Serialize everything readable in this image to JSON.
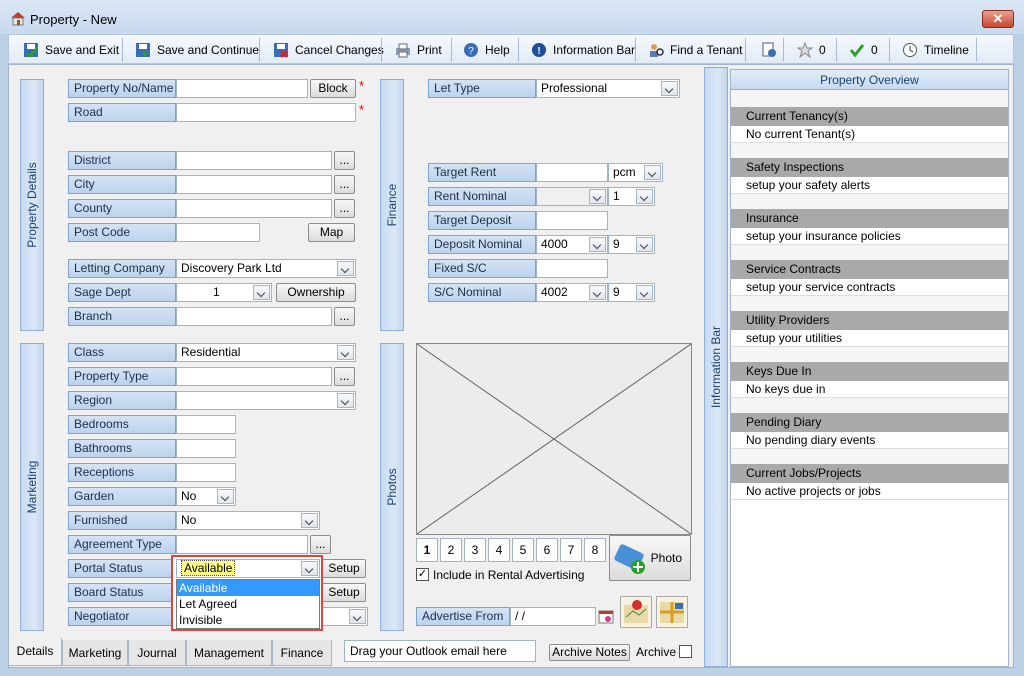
{
  "window": {
    "title": "Property  - New",
    "close": "✕"
  },
  "toolbar": {
    "save_exit": "Save and Exit",
    "save_continue": "Save and Continue",
    "cancel": "Cancel Changes",
    "print": "Print",
    "help": "Help",
    "info_bar": "Information Bar",
    "find_tenant": "Find a Tenant",
    "stars_count": "0",
    "checks_count": "0",
    "timeline": "Timeline"
  },
  "sections": {
    "property_details": "Property Details",
    "marketing": "Marketing",
    "finance": "Finance",
    "photos": "Photos",
    "information_bar": "Information Bar"
  },
  "property": {
    "no_name_label": "Property No/Name",
    "no_name_value": "",
    "block_btn": "Block",
    "road_label": "Road",
    "road_value": "",
    "district_label": "District",
    "city_label": "City",
    "county_label": "County",
    "postcode_label": "Post Code",
    "map_btn": "Map",
    "letting_company_label": "Letting Company",
    "letting_company_value": "Discovery Park Ltd",
    "sage_dept_label": "Sage Dept",
    "sage_dept_value": "1",
    "ownership_btn": "Ownership",
    "branch_label": "Branch",
    "ellipsis": "...",
    "required": "*"
  },
  "marketing": {
    "class_label": "Class",
    "class_value": "Residential",
    "property_type_label": "Property Type",
    "region_label": "Region",
    "bedrooms_label": "Bedrooms",
    "bathrooms_label": "Bathrooms",
    "receptions_label": "Receptions",
    "garden_label": "Garden",
    "garden_value": "No",
    "furnished_label": "Furnished",
    "furnished_value": "No",
    "agreement_type_label": "Agreement Type",
    "portal_status_label": "Portal Status",
    "portal_status_value": "Available",
    "portal_options": [
      "Available",
      "Let Agreed",
      "Invisible"
    ],
    "setup_btn": "Setup",
    "board_status_label": "Board Status",
    "negotiator_label": "Negotiator"
  },
  "finance": {
    "let_type_label": "Let Type",
    "let_type_value": "Professional",
    "target_rent_label": "Target Rent",
    "target_rent_period": "pcm",
    "rent_nominal_label": "Rent Nominal",
    "rent_nominal_value": "1",
    "target_deposit_label": "Target Deposit",
    "deposit_nominal_label": "Deposit Nominal",
    "deposit_nominal_code": "4000",
    "deposit_nominal_value": "9",
    "fixed_sc_label": "Fixed S/C",
    "sc_nominal_label": "S/C Nominal",
    "sc_nominal_code": "4002",
    "sc_nominal_value": "9"
  },
  "photos": {
    "tabs": [
      "1",
      "2",
      "3",
      "4",
      "5",
      "6",
      "7",
      "8"
    ],
    "photo_btn": "Photo",
    "include_label": "Include in  Rental Advertising",
    "advertise_from_label": "Advertise From",
    "advertise_from_value": " / /"
  },
  "overview": {
    "title": "Property Overview",
    "sections": [
      {
        "heading": "Current Tenancy(s)",
        "text": "No current Tenant(s)"
      },
      {
        "heading": "Safety Inspections",
        "text": "setup your safety alerts"
      },
      {
        "heading": "Insurance",
        "text": "setup your insurance policies"
      },
      {
        "heading": "Service Contracts",
        "text": "setup your service contracts"
      },
      {
        "heading": "Utility Providers",
        "text": "setup your utilities"
      },
      {
        "heading": "Keys Due In",
        "text": "No keys due in"
      },
      {
        "heading": "Pending Diary",
        "text": "No pending diary events"
      },
      {
        "heading": "Current Jobs/Projects",
        "text": "No active projects or jobs"
      }
    ]
  },
  "bottom": {
    "tabs": [
      "Details",
      "Marketing",
      "Journal",
      "Management",
      "Finance"
    ],
    "outlook_drop": "Drag your Outlook email here",
    "archive_notes_btn": "Archive Notes",
    "archive_label": "Archive"
  }
}
